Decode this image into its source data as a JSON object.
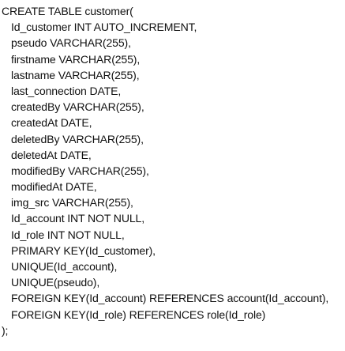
{
  "sql": {
    "open": "CREATE TABLE customer(",
    "lines": [
      "Id_customer INT AUTO_INCREMENT,",
      "pseudo VARCHAR(255),",
      "firstname VARCHAR(255),",
      "lastname VARCHAR(255),",
      "last_connection DATE,",
      "createdBy VARCHAR(255),",
      "createdAt DATE,",
      "deletedBy VARCHAR(255),",
      "deletedAt DATE,",
      "modifiedBy VARCHAR(255),",
      "modifiedAt DATE,",
      "img_src VARCHAR(255),",
      "Id_account INT NOT NULL,",
      "Id_role INT NOT NULL,",
      "PRIMARY KEY(Id_customer),",
      "UNIQUE(Id_account),",
      "UNIQUE(pseudo),",
      "FOREIGN KEY(Id_account) REFERENCES account(Id_account),",
      "FOREIGN KEY(Id_role) REFERENCES role(Id_role)"
    ],
    "close": ");"
  }
}
